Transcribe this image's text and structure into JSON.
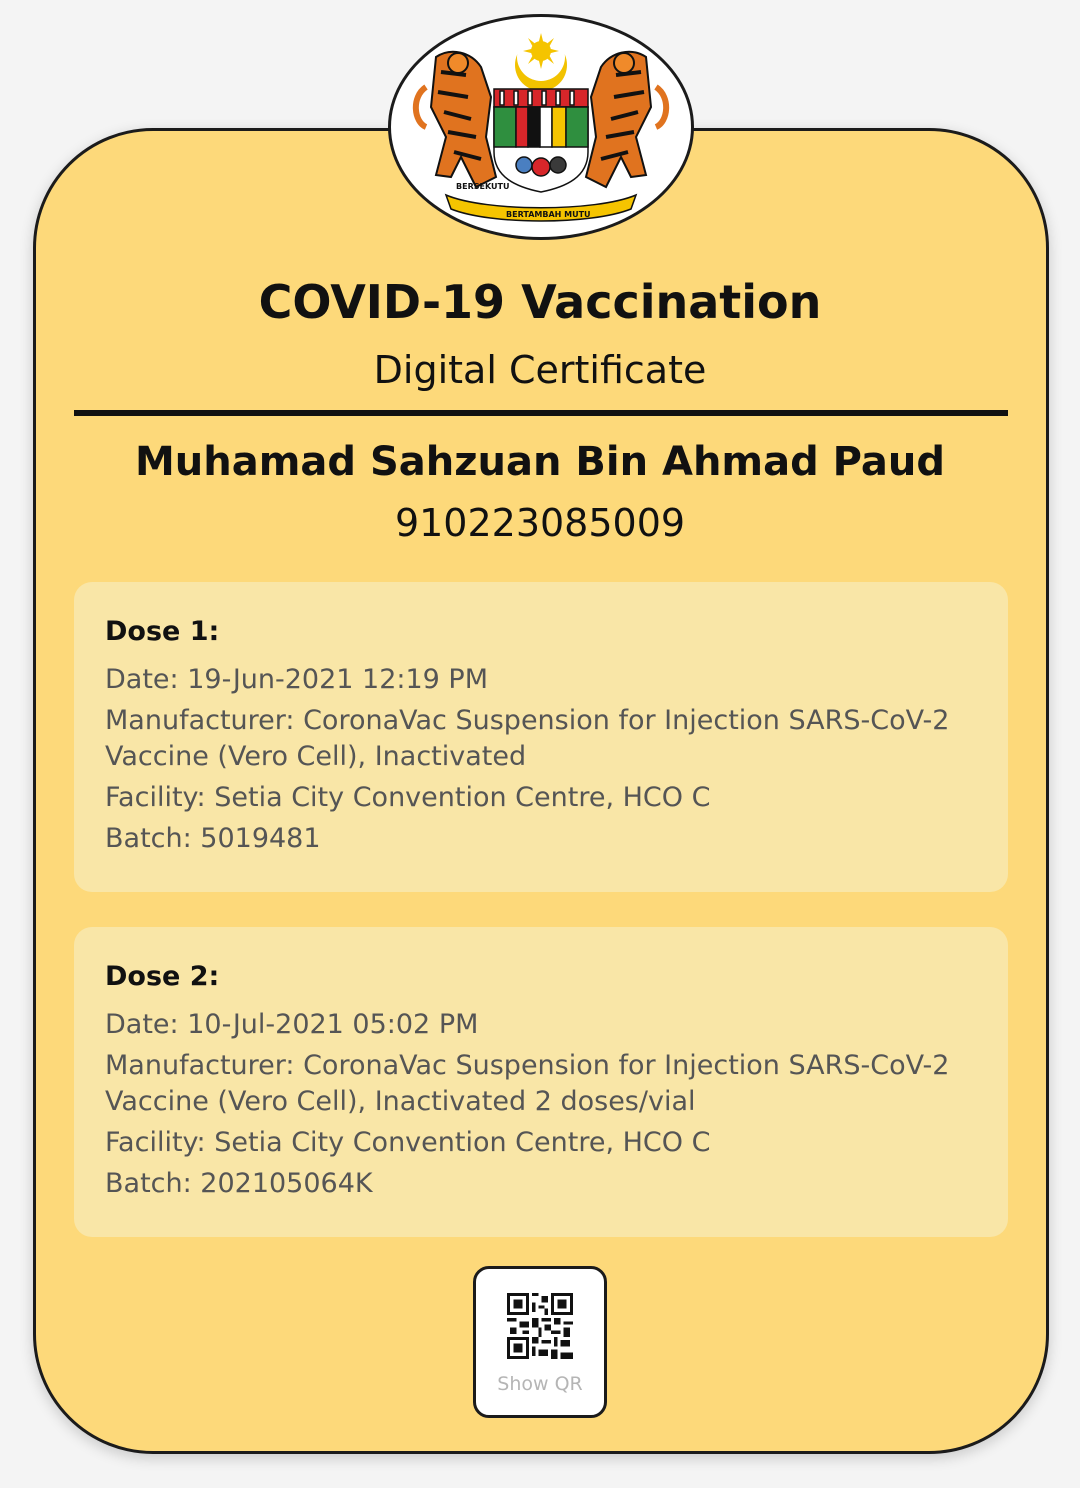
{
  "certificate": {
    "title": "COVID-19 Vaccination",
    "subtitle": "Digital Certificate",
    "holder_name": "Muhamad Sahzuan Bin Ahmad Paud",
    "holder_id": "910223085009"
  },
  "doses": [
    {
      "title": "Dose 1:",
      "date": "Date: 19-Jun-2021 12:19 PM",
      "manufacturer": "Manufacturer: CoronaVac Suspension for Injection SARS-CoV-2 Vaccine (Vero Cell), Inactivated",
      "facility": "Facility: Setia City Convention Centre, HCO C",
      "batch": "Batch: 5019481"
    },
    {
      "title": "Dose 2:",
      "date": "Date: 10-Jul-2021 05:02 PM",
      "manufacturer": "Manufacturer: CoronaVac Suspension for Injection SARS-CoV-2 Vaccine (Vero Cell), Inactivated 2 doses/vial",
      "facility": "Facility: Setia City Convention Centre, HCO C",
      "batch": "Batch: 202105064K"
    }
  ],
  "qr_button": {
    "label": "Show QR",
    "icon": "qr-code-icon"
  },
  "emblem": {
    "icon": "coat-of-arms-icon",
    "motto_left": "BERSEKUTU",
    "motto_center": "BERTAMBAH MUTU"
  },
  "colors": {
    "card_background": "#fdd97a",
    "dose_background": "#f9e6a7",
    "border": "#1b1b1b"
  }
}
